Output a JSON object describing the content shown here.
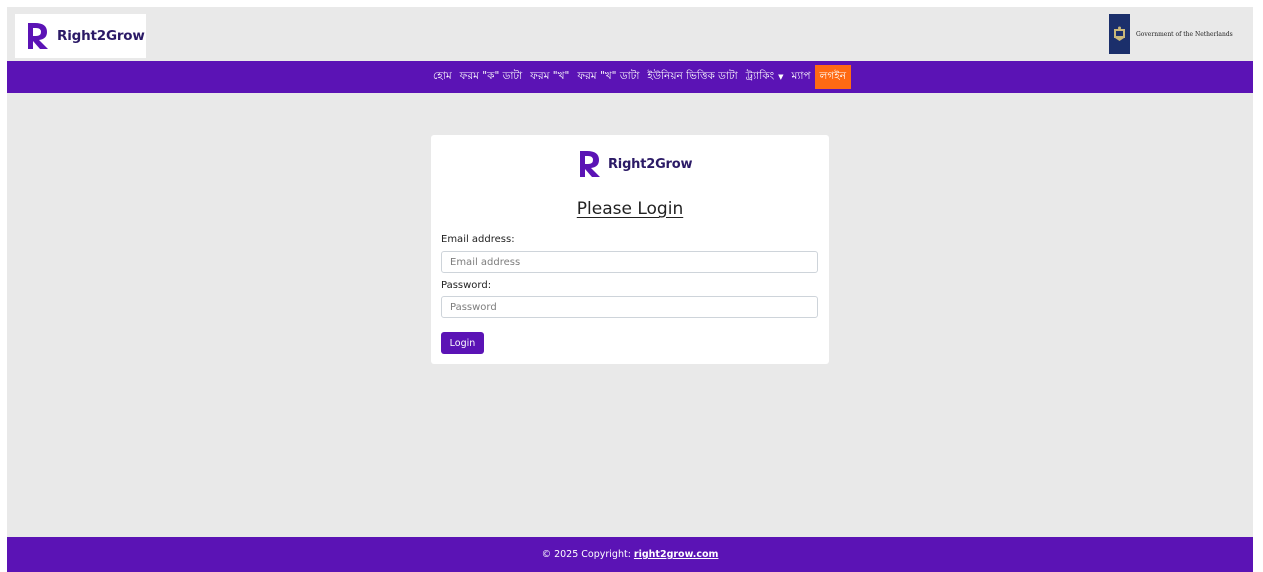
{
  "brand": {
    "name": "Right2Grow",
    "color": "#5b13b5",
    "accent": "#ff6a13"
  },
  "partner": {
    "name": "Government of the Netherlands"
  },
  "nav": {
    "items": [
      {
        "label": "হোম"
      },
      {
        "label": "ফরম \"ক\" ডাটা"
      },
      {
        "label": "ফরম \"খ\""
      },
      {
        "label": "ফরম \"খ\" ডাটা"
      },
      {
        "label": "ইউনিয়ন ভিত্তিক ডাটা"
      },
      {
        "label": "ট্র্যাকিং",
        "dropdown": true,
        "icon": "chevron-down-icon"
      },
      {
        "label": "ম্যাপ"
      },
      {
        "label": "লগইন",
        "active": true
      }
    ]
  },
  "login": {
    "title": "Please Login",
    "email_label": "Email address:",
    "email_placeholder": "Email address",
    "email_value": "",
    "password_label": "Password:",
    "password_placeholder": "Password",
    "password_value": "",
    "submit_label": "Login"
  },
  "footer": {
    "copyright": "© 2025 Copyright:",
    "link_text": "right2grow.com"
  }
}
